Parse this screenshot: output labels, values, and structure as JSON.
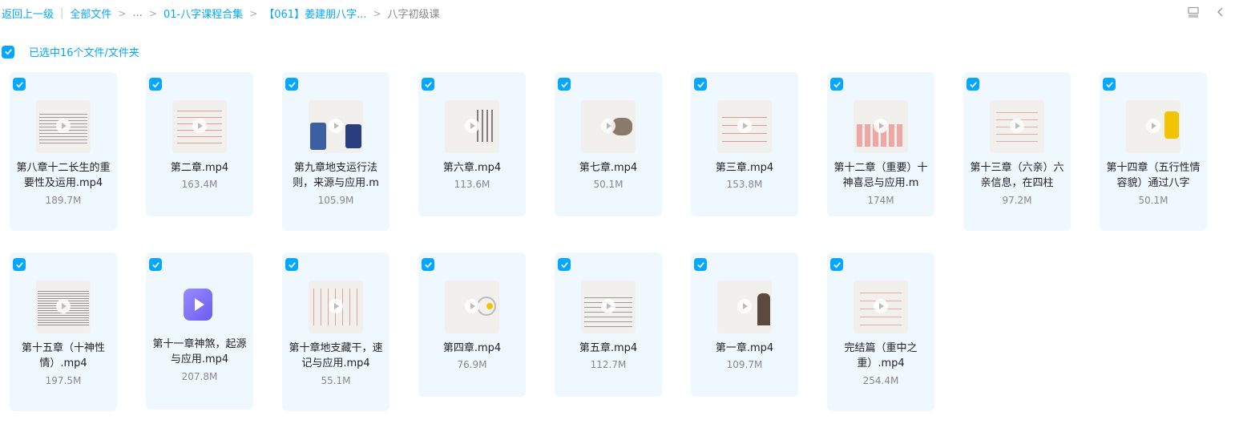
{
  "breadcrumb": {
    "back": "返回上一级",
    "all_files": "全部文件",
    "ellipsis": "...",
    "level1": "01-八字课程合集",
    "level2": "【061】姜建朋八字...",
    "current": "八字初级课"
  },
  "selection": {
    "label": "已选中16个文件/文件夹"
  },
  "files": [
    {
      "name": "第八章十二长生的重要性及运用.mp4",
      "size": "189.7M"
    },
    {
      "name": "第二章.mp4",
      "size": "163.4M"
    },
    {
      "name": "第九章地支运行法则，来源与应用.m",
      "size": "105.9M"
    },
    {
      "name": "第六章.mp4",
      "size": "113.6M"
    },
    {
      "name": "第七章.mp4",
      "size": "50.1M"
    },
    {
      "name": "第三章.mp4",
      "size": "153.8M"
    },
    {
      "name": "第十二章（重要）十神喜忌与应用.m",
      "size": "174M"
    },
    {
      "name": "第十三章（六亲）六亲信息，在四柱",
      "size": "97.2M"
    },
    {
      "name": "第十四章（五行性情容貌）通过八字",
      "size": "50.1M"
    },
    {
      "name": "第十五章（十神性情）.mp4",
      "size": "197.5M"
    },
    {
      "name": "第十一章神煞，起源与应用.mp4",
      "size": "207.8M"
    },
    {
      "name": "第十章地支藏干，速记与应用.mp4",
      "size": "55.1M"
    },
    {
      "name": "第四章.mp4",
      "size": "76.9M"
    },
    {
      "name": "第五章.mp4",
      "size": "112.7M"
    },
    {
      "name": "第一章.mp4",
      "size": "109.7M"
    },
    {
      "name": "完结篇（重中之重）.mp4",
      "size": "254.4M"
    }
  ],
  "colors": {
    "accent": "#06a7ff",
    "card_bg": "#f0f8ff",
    "video_icon": "#7b6cf6"
  },
  "icons": {
    "list_view": "list-view-icon",
    "collapse": "chevron-left-icon"
  }
}
